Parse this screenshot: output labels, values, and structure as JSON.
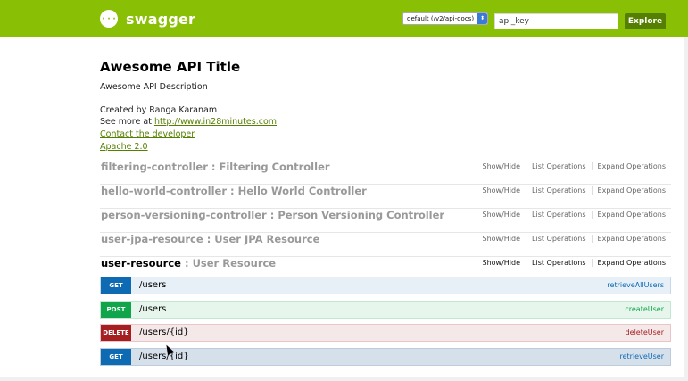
{
  "header": {
    "logo_glyph": "{···}",
    "logo_text": "swagger",
    "spec_select": "default (/v2/api-docs)",
    "spec_arrows": "⬍",
    "api_key": "api_key",
    "explore_label": "Explore",
    "brand_color": "#89bf04"
  },
  "info": {
    "title": "Awesome API Title",
    "description": "Awesome API Description",
    "created_by": "Created by Ranga Karanam",
    "see_more_prefix": "See more at ",
    "see_more_link": "http://www.in28minutes.com",
    "contact": "Contact the developer",
    "license": "Apache 2.0"
  },
  "resources": [
    {
      "name": "filtering-controller",
      "desc": " : Filtering Controller",
      "show_hide": "Show/Hide",
      "list_ops": "List Operations",
      "expand_ops": "Expand Operations"
    },
    {
      "name": "hello-world-controller",
      "desc": " : Hello World Controller",
      "show_hide": "Show/Hide",
      "list_ops": "List Operations",
      "expand_ops": "Expand Operations"
    },
    {
      "name": "person-versioning-controller",
      "desc": " : Person Versioning Controller",
      "show_hide": "Show/Hide",
      "list_ops": "List Operations",
      "expand_ops": "Expand Operations"
    },
    {
      "name": "user-jpa-resource",
      "desc": " : User JPA Resource",
      "show_hide": "Show/Hide",
      "list_ops": "List Operations",
      "expand_ops": "Expand Operations"
    },
    {
      "name": "user-resource",
      "desc": " : User Resource",
      "show_hide": "Show/Hide",
      "list_ops": "List Operations",
      "expand_ops": "Expand Operations"
    }
  ],
  "operations": [
    {
      "method": "GET",
      "path": "/users",
      "summary": "retrieveAllUsers"
    },
    {
      "method": "POST",
      "path": "/users",
      "summary": "createUser"
    },
    {
      "method": "DELETE",
      "path": "/users/{id}",
      "summary": "deleteUser"
    },
    {
      "method": "GET",
      "path": "/users/{id}",
      "summary": "retrieveUser"
    }
  ],
  "colors": {
    "get": "#0f6ab4",
    "post": "#10a54a",
    "delete": "#a41e22",
    "explore_button": "#547f00"
  }
}
